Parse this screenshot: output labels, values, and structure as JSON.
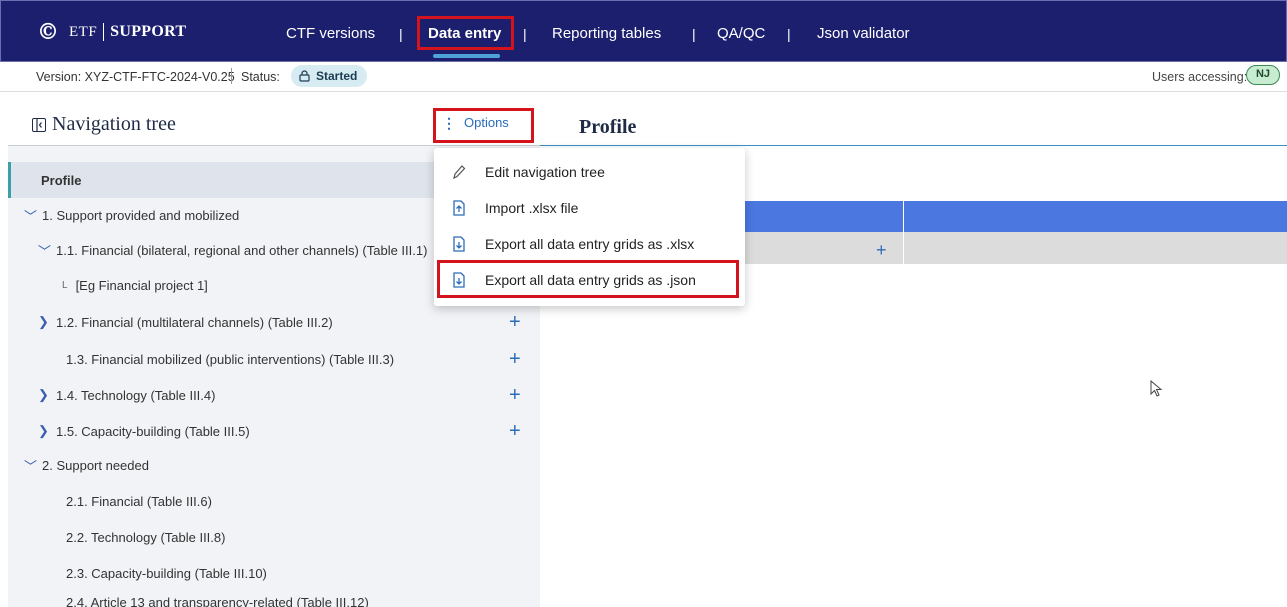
{
  "header": {
    "logo_etf": "ETF",
    "logo_support": "SUPPORT",
    "nav": [
      {
        "label": "CTF versions"
      },
      {
        "label": "Data entry"
      },
      {
        "label": "Reporting tables"
      },
      {
        "label": "QA/QC"
      },
      {
        "label": "Json validator"
      }
    ],
    "separator": "|"
  },
  "subbar": {
    "version": "Version: XYZ-CTF-FTC-2024-V0.25",
    "status_label": "Status:",
    "status_value": "Started",
    "users_label": "Users accessing:",
    "user_initials": "NJ"
  },
  "left_panel": {
    "title": "Navigation tree",
    "options_label": "Options",
    "items": [
      {
        "label": "Profile"
      },
      {
        "label": "1. Support provided and mobilized"
      },
      {
        "label": "1.1. Financial (bilateral, regional and other channels) (Table III.1)"
      },
      {
        "label": "[Eg Financial project 1]"
      },
      {
        "label": "1.2. Financial (multilateral channels) (Table III.2)"
      },
      {
        "label": "1.3. Financial mobilized (public interventions) (Table III.3)"
      },
      {
        "label": "1.4. Technology (Table III.4)"
      },
      {
        "label": "1.5. Capacity-building (Table III.5)"
      },
      {
        "label": "2. Support needed"
      },
      {
        "label": "2.1. Financial (Table III.6)"
      },
      {
        "label": "2.2. Technology (Table III.8)"
      },
      {
        "label": "2.3. Capacity-building (Table III.10)"
      },
      {
        "label": "2.4. Article 13 and transparency-related (Table III.12)"
      }
    ],
    "leaf_marker": "L",
    "add_symbol": "+"
  },
  "main": {
    "title": "Profile"
  },
  "options_menu": {
    "items": [
      {
        "label": "Edit navigation tree",
        "icon": "pencil-icon"
      },
      {
        "label": "Import .xlsx file",
        "icon": "file-import-icon"
      },
      {
        "label": "Export all data entry grids as .xlsx",
        "icon": "file-export-icon"
      },
      {
        "label": "Export all data entry grids as .json",
        "icon": "file-export-icon"
      }
    ]
  },
  "colors": {
    "navbar": "#1c1f6e",
    "highlight_box": "#d3141c",
    "accent_blue": "#2b6cb8",
    "grid_header": "#4a78e0"
  }
}
